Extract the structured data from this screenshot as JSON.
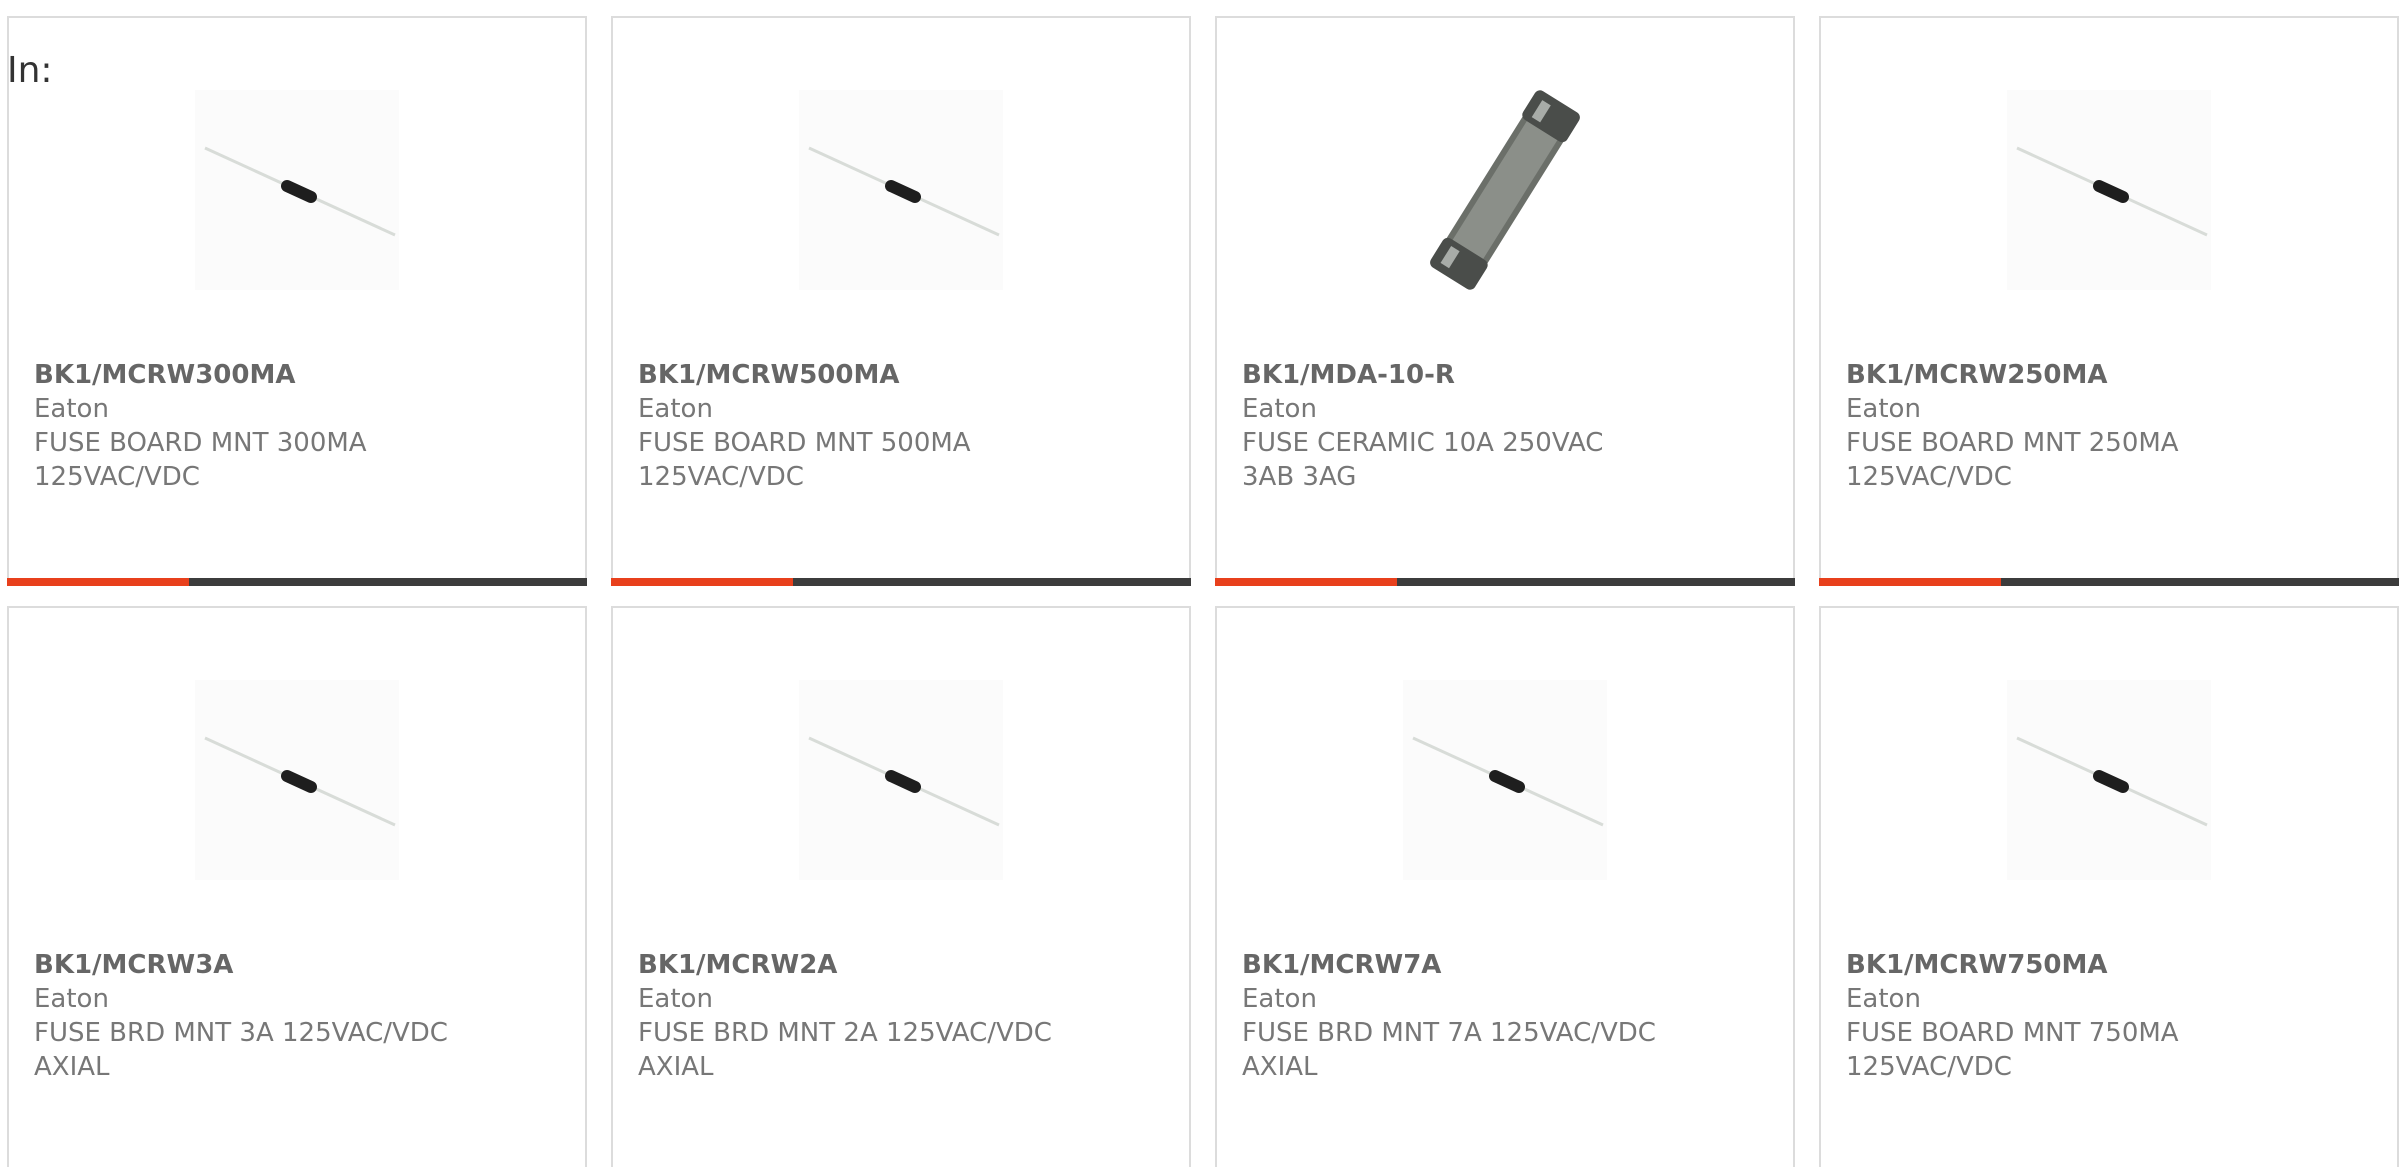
{
  "header": {
    "in_label": "In:"
  },
  "colors": {
    "accent": "#e8401c",
    "bar_dark": "#3c3c3c",
    "card_border": "#dcdcdc",
    "text": "#777777"
  },
  "products": [
    {
      "part_number": "BK1/MCRW300MA",
      "manufacturer": "Eaton",
      "description": "FUSE BOARD MNT 300MA 125VAC/VDC",
      "image": "axial-fuse-icon"
    },
    {
      "part_number": "BK1/MCRW500MA",
      "manufacturer": "Eaton",
      "description": "FUSE BOARD MNT 500MA 125VAC/VDC",
      "image": "axial-fuse-icon"
    },
    {
      "part_number": "BK1/MDA-10-R",
      "manufacturer": "Eaton",
      "description": "FUSE CERAMIC 10A 250VAC 3AB 3AG",
      "image": "ceramic-fuse-icon"
    },
    {
      "part_number": "BK1/MCRW250MA",
      "manufacturer": "Eaton",
      "description": "FUSE BOARD MNT 250MA 125VAC/VDC",
      "image": "axial-fuse-icon"
    },
    {
      "part_number": "BK1/MCRW3A",
      "manufacturer": "Eaton",
      "description": "FUSE BRD MNT 3A 125VAC/VDC AXIAL",
      "image": "axial-fuse-icon"
    },
    {
      "part_number": "BK1/MCRW2A",
      "manufacturer": "Eaton",
      "description": "FUSE BRD MNT 2A 125VAC/VDC AXIAL",
      "image": "axial-fuse-icon"
    },
    {
      "part_number": "BK1/MCRW7A",
      "manufacturer": "Eaton",
      "description": "FUSE BRD MNT 7A 125VAC/VDC AXIAL",
      "image": "axial-fuse-icon"
    },
    {
      "part_number": "BK1/MCRW750MA",
      "manufacturer": "Eaton",
      "description": "FUSE BOARD MNT 750MA 125VAC/VDC",
      "image": "axial-fuse-icon"
    }
  ]
}
